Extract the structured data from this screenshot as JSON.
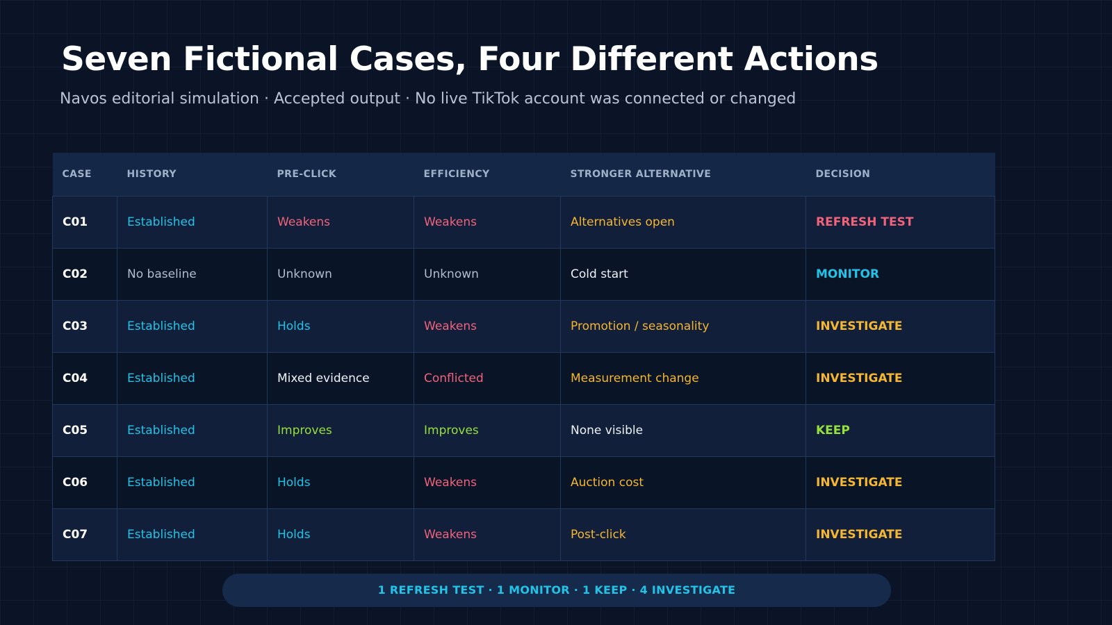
{
  "header": {
    "title": "Seven Fictional Cases, Four Different Actions",
    "subtitle": "Navos editorial simulation · Accepted output · No live TikTok account was connected or changed"
  },
  "table": {
    "columns": [
      "CASE",
      "HISTORY",
      "PRE-CLICK",
      "EFFICIENCY",
      "STRONGER ALTERNATIVE",
      "DECISION"
    ],
    "rows": [
      {
        "case": "C01",
        "history": "Established",
        "preclick": "Weakens",
        "efficiency": "Weakens",
        "alternative": "Alternatives open",
        "decision": "REFRESH TEST"
      },
      {
        "case": "C02",
        "history": "No baseline",
        "preclick": "Unknown",
        "efficiency": "Unknown",
        "alternative": "Cold start",
        "decision": "MONITOR"
      },
      {
        "case": "C03",
        "history": "Established",
        "preclick": "Holds",
        "efficiency": "Weakens",
        "alternative": "Promotion / seasonality",
        "decision": "INVESTIGATE"
      },
      {
        "case": "C04",
        "history": "Established",
        "preclick": "Mixed evidence",
        "efficiency": "Conflicted",
        "alternative": "Measurement change",
        "decision": "INVESTIGATE"
      },
      {
        "case": "C05",
        "history": "Established",
        "preclick": "Improves",
        "efficiency": "Improves",
        "alternative": "None visible",
        "decision": "KEEP"
      },
      {
        "case": "C06",
        "history": "Established",
        "preclick": "Holds",
        "efficiency": "Weakens",
        "alternative": "Auction cost",
        "decision": "INVESTIGATE"
      },
      {
        "case": "C07",
        "history": "Established",
        "preclick": "Holds",
        "efficiency": "Weakens",
        "alternative": "Post-click",
        "decision": "INVESTIGATE"
      }
    ]
  },
  "summary": "1 REFRESH TEST · 1 MONITOR · 1 KEEP · 4 INVESTIGATE",
  "colors": {
    "background": "#0a1426",
    "cyan": "#22c3e6",
    "pink": "#f0637a",
    "amber": "#f5b631",
    "green": "#96e03c",
    "gray": "#b2bdcc",
    "white": "#eef2f8"
  }
}
